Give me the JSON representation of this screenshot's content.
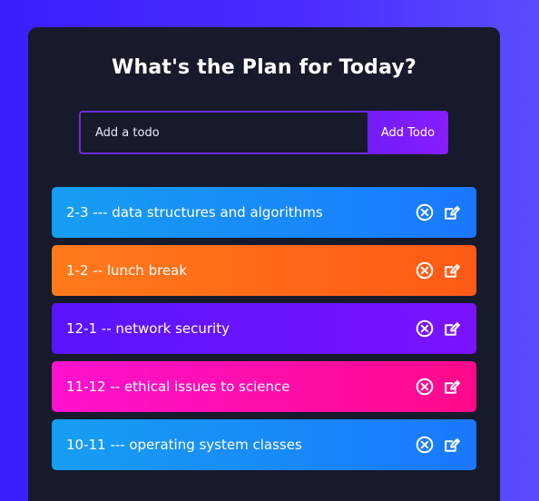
{
  "app": {
    "title": "What's the Plan for Today?"
  },
  "form": {
    "input_placeholder": "Add a todo",
    "input_value": "",
    "add_button_label": "Add Todo"
  },
  "todos": [
    {
      "text": "2-3 --- data structures and algorithms",
      "color": "#169ef2"
    },
    {
      "text": "1-2 -- lunch break",
      "color": "#ff7a1a"
    },
    {
      "text": "12-1 -- network security",
      "color": "#5a14ff"
    },
    {
      "text": "11-12 -- ethical issues to science",
      "color": "#ff12cf"
    },
    {
      "text": "10-11 --- operating system classes",
      "color": "#169ef2"
    }
  ],
  "icons": {
    "delete": "close-circle-icon",
    "edit": "edit-icon"
  }
}
